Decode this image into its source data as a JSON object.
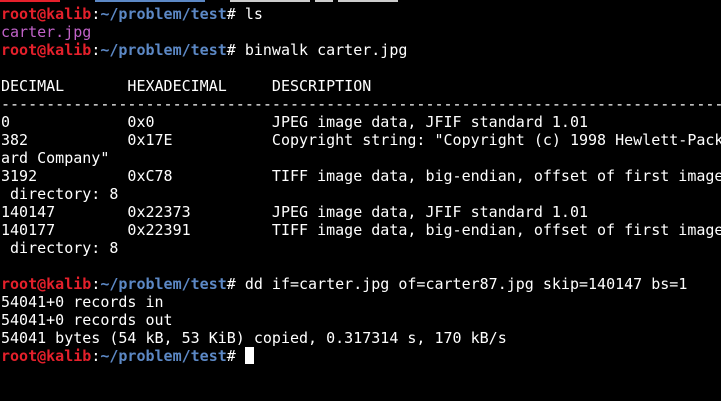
{
  "prompt": {
    "user": "root@kalib",
    "sep": ":",
    "path": "~/problem/test",
    "sym": "# "
  },
  "lines": [
    {
      "type": "prompt",
      "cmd": "ls"
    },
    {
      "type": "file",
      "text": "carter.jpg"
    },
    {
      "type": "prompt",
      "cmd": "binwalk carter.jpg"
    },
    {
      "type": "text",
      "text": ""
    },
    {
      "type": "text",
      "text": "DECIMAL       HEXADECIMAL     DESCRIPTION"
    },
    {
      "type": "text",
      "text": "--------------------------------------------------------------------------------"
    },
    {
      "type": "text",
      "text": "0             0x0             JPEG image data, JFIF standard 1.01"
    },
    {
      "type": "text",
      "text": "382           0x17E           Copyright string: \"Copyright (c) 1998 Hewlett-Pack"
    },
    {
      "type": "text",
      "text": "ard Company\""
    },
    {
      "type": "text",
      "text": "3192          0xC78           TIFF image data, big-endian, offset of first image"
    },
    {
      "type": "text",
      "text": " directory: 8"
    },
    {
      "type": "text",
      "text": "140147        0x22373         JPEG image data, JFIF standard 1.01"
    },
    {
      "type": "text",
      "text": "140177        0x22391         TIFF image data, big-endian, offset of first image"
    },
    {
      "type": "text",
      "text": " directory: 8"
    },
    {
      "type": "text",
      "text": ""
    },
    {
      "type": "prompt",
      "cmd": "dd if=carter.jpg of=carter87.jpg skip=140147 bs=1"
    },
    {
      "type": "text",
      "text": "54041+0 records in"
    },
    {
      "type": "text",
      "text": "54041+0 records out"
    },
    {
      "type": "text",
      "text": "54041 bytes (54 kB, 53 KiB) copied, 0.317314 s, 170 kB/s"
    },
    {
      "type": "prompt",
      "cmd": "",
      "cursor": true
    }
  ],
  "colors": {
    "background": "#000000",
    "user": "#e5202b",
    "path": "#5c88c5",
    "file": "#c162c8",
    "text": "#ffffff"
  }
}
